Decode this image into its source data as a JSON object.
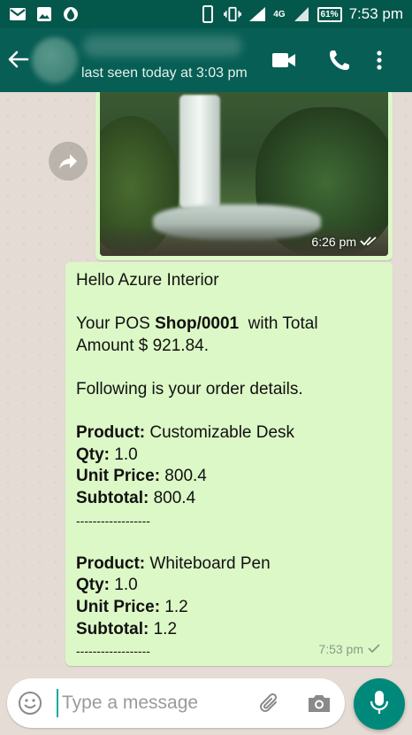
{
  "status_bar": {
    "time": "7:53 pm",
    "battery": "61%",
    "network": "4G",
    "icons": [
      "gmail-icon",
      "gallery-icon",
      "data-saver-icon",
      "vibrate-icon",
      "signal-icon",
      "battery-icon"
    ]
  },
  "header": {
    "last_seen": "last seen today at 3:03 pm",
    "icons": [
      "back-arrow-icon",
      "video-call-icon",
      "phone-call-icon",
      "more-options-icon"
    ]
  },
  "messages": {
    "image_message": {
      "time": "6:26 pm",
      "status": "read"
    },
    "text_message": {
      "greeting": "Hello Azure Interior",
      "line1_prefix": "Your POS ",
      "line1_bold": "Shop/0001",
      "line1_suffix": "  with Total",
      "line2": "Amount $ 921.84.",
      "line3": "Following is your order details.",
      "items": [
        {
          "product_label": "Product:",
          "product": " Customizable Desk",
          "qty_label": "Qty:",
          "qty": " 1.0",
          "unit_price_label": "Unit Price:",
          "unit_price": " 800.4",
          "subtotal_label": "Subtotal:",
          "subtotal": " 800.4",
          "separator": "------------------"
        },
        {
          "product_label": "Product:",
          "product": " Whiteboard Pen",
          "qty_label": "Qty:",
          "qty": " 1.0",
          "unit_price_label": "Unit Price:",
          "unit_price": " 1.2",
          "subtotal_label": "Subtotal:",
          "subtotal": " 1.2",
          "separator": "------------------"
        }
      ],
      "time": "7:53 pm",
      "status": "delivered"
    }
  },
  "composer": {
    "placeholder": "Type a message"
  },
  "colors": {
    "header": "#075e54",
    "status_bar": "#04574b",
    "outgoing_bubble": "#dcf8c6",
    "mic_button": "#00897b",
    "chat_background": "#e5ddd5"
  }
}
